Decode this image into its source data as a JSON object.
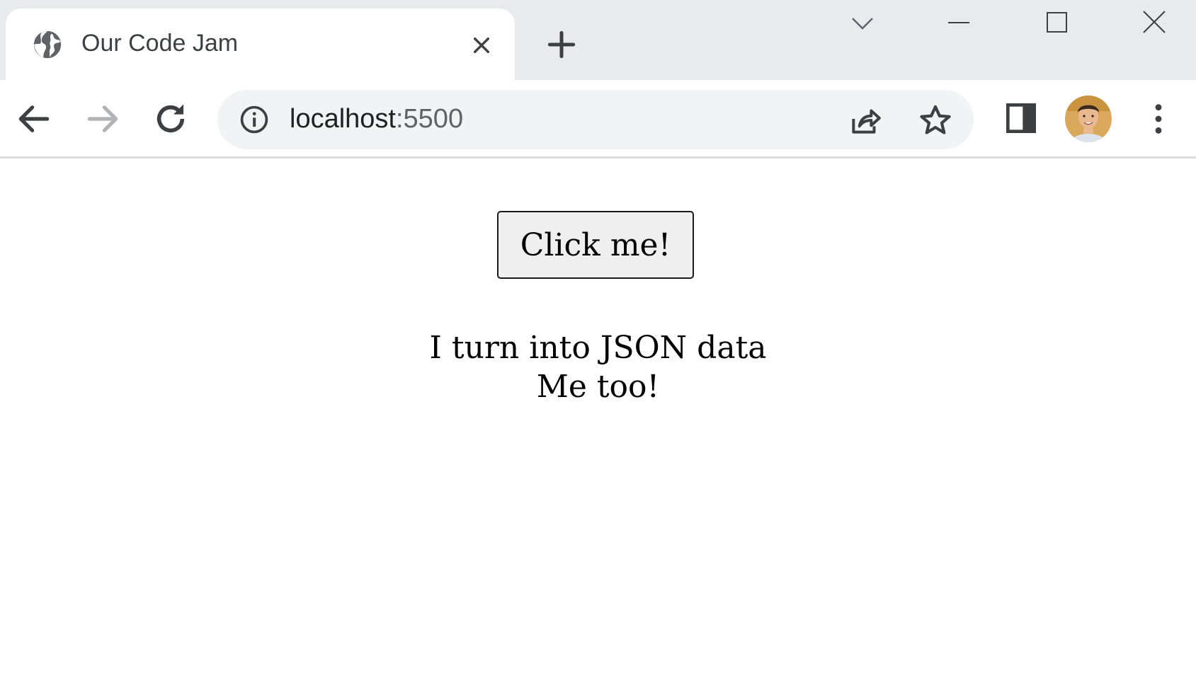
{
  "browser": {
    "tab": {
      "title": "Our Code Jam",
      "favicon": "globe-icon"
    },
    "address_bar": {
      "host": "localhost",
      "port": ":5500"
    },
    "icons": {
      "back": "arrow-left-icon",
      "forward": "arrow-right-icon",
      "reload": "reload-icon",
      "info": "info-icon",
      "share": "share-icon",
      "bookmark": "star-icon",
      "side_panel": "side-panel-icon",
      "menu": "kebab-menu-icon",
      "tab_search": "chevron-down-icon",
      "minimize": "minimize-icon",
      "maximize": "maximize-icon",
      "close": "close-icon",
      "new_tab": "plus-icon"
    },
    "colors": {
      "tabstrip_bg": "#e8eaed",
      "omnibox_bg": "#f1f3f4",
      "icon_color": "#5f6368",
      "icon_disabled": "#b1b3b6"
    }
  },
  "page": {
    "button_label": "Click me!",
    "output_lines": [
      "I turn into JSON data",
      "Me too!"
    ]
  }
}
